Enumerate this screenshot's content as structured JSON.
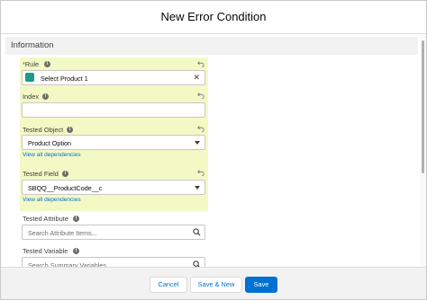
{
  "modal": {
    "title": "New Error Condition"
  },
  "section": {
    "title": "Information"
  },
  "fields": {
    "rule": {
      "required_mark": "*",
      "label": "Rule",
      "value": "Select Product 1"
    },
    "index": {
      "label": "Index",
      "value": ""
    },
    "tested_object": {
      "label": "Tested Object",
      "value": "Product Option",
      "link": "View all dependencies"
    },
    "tested_field": {
      "label": "Tested Field",
      "value": "SBQQ__ProductCode__c",
      "link": "View all dependencies"
    },
    "tested_attribute": {
      "label": "Tested Attribute",
      "placeholder": "Search Attribute Items..."
    },
    "tested_variable": {
      "label": "Tested Variable",
      "placeholder": "Search Summary Variables..."
    }
  },
  "footer": {
    "cancel_label": "Cancel",
    "save_new_label": "Save & New",
    "save_label": "Save"
  },
  "colors": {
    "highlight": "#f3f9c5",
    "brand": "#0070d2"
  },
  "icons": [
    "info-icon",
    "undo-icon",
    "close-icon",
    "chevron-down-icon",
    "search-icon",
    "rule-record-icon"
  ]
}
